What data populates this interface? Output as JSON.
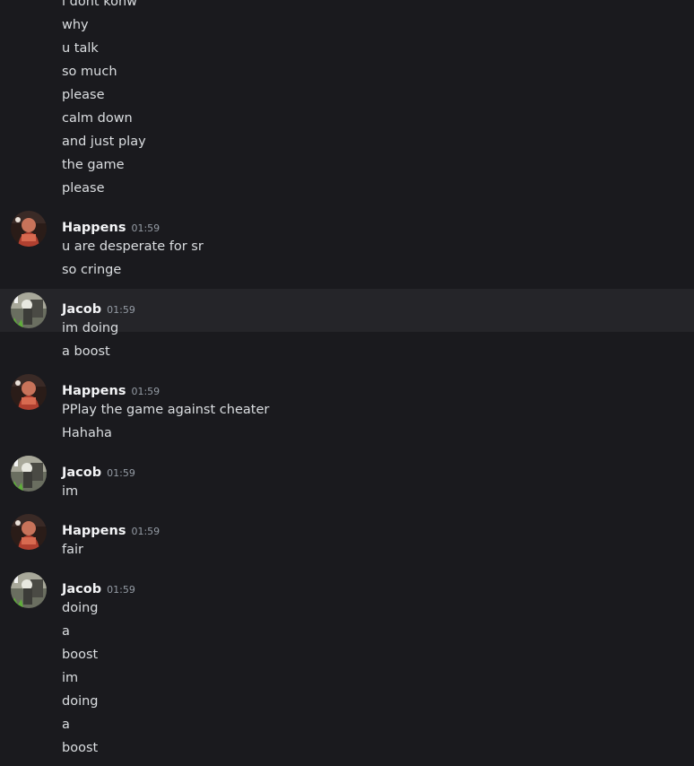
{
  "messages": [
    {
      "type": "line",
      "text": "i dont konw"
    },
    {
      "type": "line",
      "text": "why"
    },
    {
      "type": "line",
      "text": "u talk"
    },
    {
      "type": "line",
      "text": "so much"
    },
    {
      "type": "line",
      "text": "please"
    },
    {
      "type": "line",
      "text": "calm down"
    },
    {
      "type": "line",
      "text": "and just play"
    },
    {
      "type": "line",
      "text": "the game"
    },
    {
      "type": "line",
      "text": "please"
    },
    {
      "type": "header",
      "author": "Happens",
      "time": "01:59",
      "avatar": "happens-avatar"
    },
    {
      "type": "line",
      "text": "u are desperate for sr"
    },
    {
      "type": "line",
      "text": "so cringe"
    },
    {
      "type": "header",
      "author": "Jacob",
      "time": "01:59",
      "avatar": "jacob-avatar",
      "hovered": true
    },
    {
      "type": "line",
      "text": "im doing"
    },
    {
      "type": "line",
      "text": "a boost"
    },
    {
      "type": "header",
      "author": "Happens",
      "time": "01:59",
      "avatar": "happens-avatar"
    },
    {
      "type": "line",
      "text": "PPlay the game against cheater"
    },
    {
      "type": "line",
      "text": "Hahaha"
    },
    {
      "type": "header",
      "author": "Jacob",
      "time": "01:59",
      "avatar": "jacob-avatar"
    },
    {
      "type": "line",
      "text": "im"
    },
    {
      "type": "header",
      "author": "Happens",
      "time": "01:59",
      "avatar": "happens-avatar"
    },
    {
      "type": "line",
      "text": "fair"
    },
    {
      "type": "header",
      "author": "Jacob",
      "time": "01:59",
      "avatar": "jacob-avatar"
    },
    {
      "type": "line",
      "text": "doing"
    },
    {
      "type": "line",
      "text": "a"
    },
    {
      "type": "line",
      "text": "boost"
    },
    {
      "type": "line",
      "text": "im"
    },
    {
      "type": "line",
      "text": "doing"
    },
    {
      "type": "line",
      "text": "a"
    },
    {
      "type": "line",
      "text": "boost"
    }
  ],
  "colors": {
    "background": "#1a1a1e",
    "hover_background": "#252529",
    "text": "#dbdee1",
    "author": "#f2f3f5",
    "timestamp": "#949ba4"
  }
}
